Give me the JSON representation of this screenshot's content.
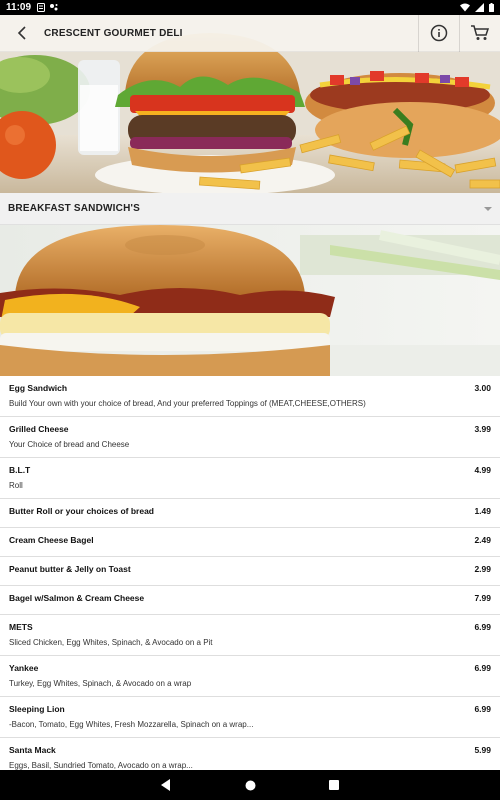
{
  "status_bar": {
    "time": "11:09"
  },
  "app_bar": {
    "title": "CRESCENT GOURMET DELI"
  },
  "category": {
    "selected": "BREAKFAST SANDWICH'S"
  },
  "menu": {
    "items": [
      {
        "name": "Egg Sandwich",
        "price": "3.00",
        "description": "Build Your own with your choice of bread, And your preferred Toppings of (MEAT,CHEESE,OTHERS)"
      },
      {
        "name": "Grilled Cheese",
        "price": "3.99",
        "description": "Your Choice of bread and Cheese"
      },
      {
        "name": "B.L.T",
        "price": "4.99",
        "description": "Roll"
      },
      {
        "name": "Butter Roll or your choices of bread",
        "price": "1.49",
        "description": ""
      },
      {
        "name": "Cream Cheese Bagel",
        "price": "2.49",
        "description": ""
      },
      {
        "name": "Peanut butter & Jelly on Toast",
        "price": "2.99",
        "description": ""
      },
      {
        "name": "Bagel w/Salmon & Cream Cheese",
        "price": "7.99",
        "description": ""
      },
      {
        "name": "METS",
        "price": "6.99",
        "description": "Sliced Chicken, Egg Whites, Spinach, & Avocado on a Pit"
      },
      {
        "name": "Yankee",
        "price": "6.99",
        "description": "Turkey, Egg Whites, Spinach, & Avocado on a wrap"
      },
      {
        "name": "Sleeping Lion",
        "price": "6.99",
        "description": "-Bacon, Tomato, Egg Whites, Fresh Mozzarella, Spinach on a wrap..."
      },
      {
        "name": "Santa Mack",
        "price": "5.99",
        "description": "Eggs, Basil, Sundried Tomato, Avocado on a wrap..."
      }
    ]
  },
  "icons": {
    "back": "back-arrow-icon",
    "info": "info-icon",
    "cart": "cart-icon",
    "nav_back": "nav-back-icon",
    "nav_home": "nav-home-icon",
    "nav_recents": "nav-recents-icon"
  }
}
